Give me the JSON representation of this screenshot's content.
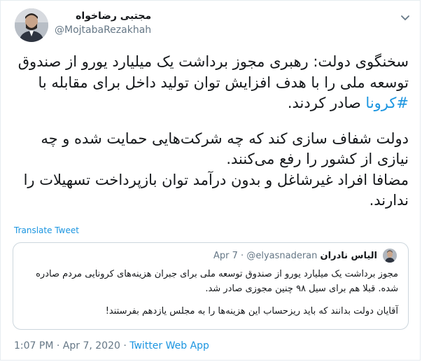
{
  "author": {
    "display_name": "مجتبی رضاخواه",
    "handle": "@MojtabaRezakhah"
  },
  "tweet": {
    "lines": [
      "سخنگوی دولت: رهبری مجوز برداشت یک میلیارد یورو از صندوق توسعه ملی را با هدف افزایش توان تولید داخل برای مقابله با",
      "دولت شفاف سازی کند که چه شرکت‌هایی حمایت شده و چه نیازی از کشور را رفع می‌کنند.",
      "مضافا افراد غیرشاغل و بدون درآمد توان بازپرداخت تسهیلات را ندارند."
    ],
    "hashtag": "#کرونا",
    "after_hashtag": "صادر کردند."
  },
  "translate_label": "Translate Tweet",
  "quoted": {
    "display_name": "الیاس نادران",
    "handle": "@elyasnaderan",
    "separator": "·",
    "date": "Apr 7",
    "paragraphs": [
      "مجوز برداشت یک میلیارد یورو از صندوق توسعه ملی برای جبران هزینه‌های کرونایی مردم صادره شده. قبلا هم برای سیل ۹۸ چنین مجوزی صادر شد.",
      "آقایان دولت بدانند که باید ریزحساب این هزینه‌ها را به مجلس یازدهم بفرستند!"
    ]
  },
  "footer": {
    "time": "1:07 PM",
    "sep1": "·",
    "date": "Apr 7, 2020",
    "sep2": "·",
    "source": "Twitter Web App"
  },
  "colors": {
    "link": "#1b95e0",
    "muted": "#657786",
    "text": "#14171a",
    "border": "#ccd6dd"
  },
  "icons": {
    "menu": "chevron-down-icon"
  }
}
